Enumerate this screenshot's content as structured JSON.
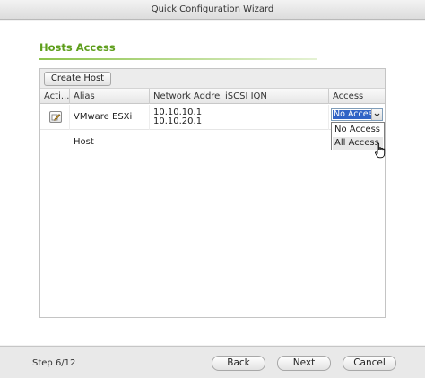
{
  "window": {
    "title": "Quick Configuration Wizard"
  },
  "section": {
    "title": "Hosts Access"
  },
  "toolbar": {
    "create_host_label": "Create Host"
  },
  "table": {
    "columns": [
      "Acti...",
      "Alias",
      "Network Address",
      "iSCSI IQN",
      "Access"
    ],
    "rows": [
      {
        "alias": "VMware ESXi Host",
        "network_addresses": [
          "10.10.10.1",
          "10.10.20.1"
        ],
        "iscsi_iqn": "",
        "access": "No Access"
      }
    ]
  },
  "access_select": {
    "selected": "No Access",
    "options": [
      "No Access",
      "All Access"
    ],
    "hovered": "All Access"
  },
  "footer": {
    "step": "Step 6/12",
    "back_label": "Back",
    "next_label": "Next",
    "cancel_label": "Cancel"
  },
  "icons": {
    "action": "edit-icon",
    "dropdown": "chevron-down-icon",
    "cursor": "hand-pointer-icon"
  },
  "colors": {
    "accent": "#5e9e1c",
    "selection": "#3163c6"
  }
}
